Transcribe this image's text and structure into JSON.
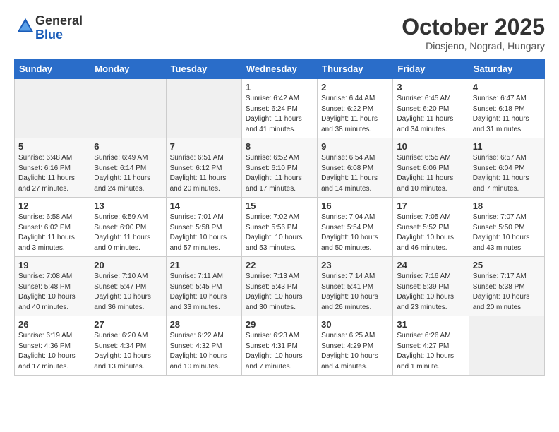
{
  "header": {
    "logo_general": "General",
    "logo_blue": "Blue",
    "month_title": "October 2025",
    "location": "Diosjeno, Nograd, Hungary"
  },
  "weekdays": [
    "Sunday",
    "Monday",
    "Tuesday",
    "Wednesday",
    "Thursday",
    "Friday",
    "Saturday"
  ],
  "weeks": [
    [
      {
        "day": "",
        "info": ""
      },
      {
        "day": "",
        "info": ""
      },
      {
        "day": "",
        "info": ""
      },
      {
        "day": "1",
        "info": "Sunrise: 6:42 AM\nSunset: 6:24 PM\nDaylight: 11 hours\nand 41 minutes."
      },
      {
        "day": "2",
        "info": "Sunrise: 6:44 AM\nSunset: 6:22 PM\nDaylight: 11 hours\nand 38 minutes."
      },
      {
        "day": "3",
        "info": "Sunrise: 6:45 AM\nSunset: 6:20 PM\nDaylight: 11 hours\nand 34 minutes."
      },
      {
        "day": "4",
        "info": "Sunrise: 6:47 AM\nSunset: 6:18 PM\nDaylight: 11 hours\nand 31 minutes."
      }
    ],
    [
      {
        "day": "5",
        "info": "Sunrise: 6:48 AM\nSunset: 6:16 PM\nDaylight: 11 hours\nand 27 minutes."
      },
      {
        "day": "6",
        "info": "Sunrise: 6:49 AM\nSunset: 6:14 PM\nDaylight: 11 hours\nand 24 minutes."
      },
      {
        "day": "7",
        "info": "Sunrise: 6:51 AM\nSunset: 6:12 PM\nDaylight: 11 hours\nand 20 minutes."
      },
      {
        "day": "8",
        "info": "Sunrise: 6:52 AM\nSunset: 6:10 PM\nDaylight: 11 hours\nand 17 minutes."
      },
      {
        "day": "9",
        "info": "Sunrise: 6:54 AM\nSunset: 6:08 PM\nDaylight: 11 hours\nand 14 minutes."
      },
      {
        "day": "10",
        "info": "Sunrise: 6:55 AM\nSunset: 6:06 PM\nDaylight: 11 hours\nand 10 minutes."
      },
      {
        "day": "11",
        "info": "Sunrise: 6:57 AM\nSunset: 6:04 PM\nDaylight: 11 hours\nand 7 minutes."
      }
    ],
    [
      {
        "day": "12",
        "info": "Sunrise: 6:58 AM\nSunset: 6:02 PM\nDaylight: 11 hours\nand 3 minutes."
      },
      {
        "day": "13",
        "info": "Sunrise: 6:59 AM\nSunset: 6:00 PM\nDaylight: 11 hours\nand 0 minutes."
      },
      {
        "day": "14",
        "info": "Sunrise: 7:01 AM\nSunset: 5:58 PM\nDaylight: 10 hours\nand 57 minutes."
      },
      {
        "day": "15",
        "info": "Sunrise: 7:02 AM\nSunset: 5:56 PM\nDaylight: 10 hours\nand 53 minutes."
      },
      {
        "day": "16",
        "info": "Sunrise: 7:04 AM\nSunset: 5:54 PM\nDaylight: 10 hours\nand 50 minutes."
      },
      {
        "day": "17",
        "info": "Sunrise: 7:05 AM\nSunset: 5:52 PM\nDaylight: 10 hours\nand 46 minutes."
      },
      {
        "day": "18",
        "info": "Sunrise: 7:07 AM\nSunset: 5:50 PM\nDaylight: 10 hours\nand 43 minutes."
      }
    ],
    [
      {
        "day": "19",
        "info": "Sunrise: 7:08 AM\nSunset: 5:48 PM\nDaylight: 10 hours\nand 40 minutes."
      },
      {
        "day": "20",
        "info": "Sunrise: 7:10 AM\nSunset: 5:47 PM\nDaylight: 10 hours\nand 36 minutes."
      },
      {
        "day": "21",
        "info": "Sunrise: 7:11 AM\nSunset: 5:45 PM\nDaylight: 10 hours\nand 33 minutes."
      },
      {
        "day": "22",
        "info": "Sunrise: 7:13 AM\nSunset: 5:43 PM\nDaylight: 10 hours\nand 30 minutes."
      },
      {
        "day": "23",
        "info": "Sunrise: 7:14 AM\nSunset: 5:41 PM\nDaylight: 10 hours\nand 26 minutes."
      },
      {
        "day": "24",
        "info": "Sunrise: 7:16 AM\nSunset: 5:39 PM\nDaylight: 10 hours\nand 23 minutes."
      },
      {
        "day": "25",
        "info": "Sunrise: 7:17 AM\nSunset: 5:38 PM\nDaylight: 10 hours\nand 20 minutes."
      }
    ],
    [
      {
        "day": "26",
        "info": "Sunrise: 6:19 AM\nSunset: 4:36 PM\nDaylight: 10 hours\nand 17 minutes."
      },
      {
        "day": "27",
        "info": "Sunrise: 6:20 AM\nSunset: 4:34 PM\nDaylight: 10 hours\nand 13 minutes."
      },
      {
        "day": "28",
        "info": "Sunrise: 6:22 AM\nSunset: 4:32 PM\nDaylight: 10 hours\nand 10 minutes."
      },
      {
        "day": "29",
        "info": "Sunrise: 6:23 AM\nSunset: 4:31 PM\nDaylight: 10 hours\nand 7 minutes."
      },
      {
        "day": "30",
        "info": "Sunrise: 6:25 AM\nSunset: 4:29 PM\nDaylight: 10 hours\nand 4 minutes."
      },
      {
        "day": "31",
        "info": "Sunrise: 6:26 AM\nSunset: 4:27 PM\nDaylight: 10 hours\nand 1 minute."
      },
      {
        "day": "",
        "info": ""
      }
    ]
  ]
}
